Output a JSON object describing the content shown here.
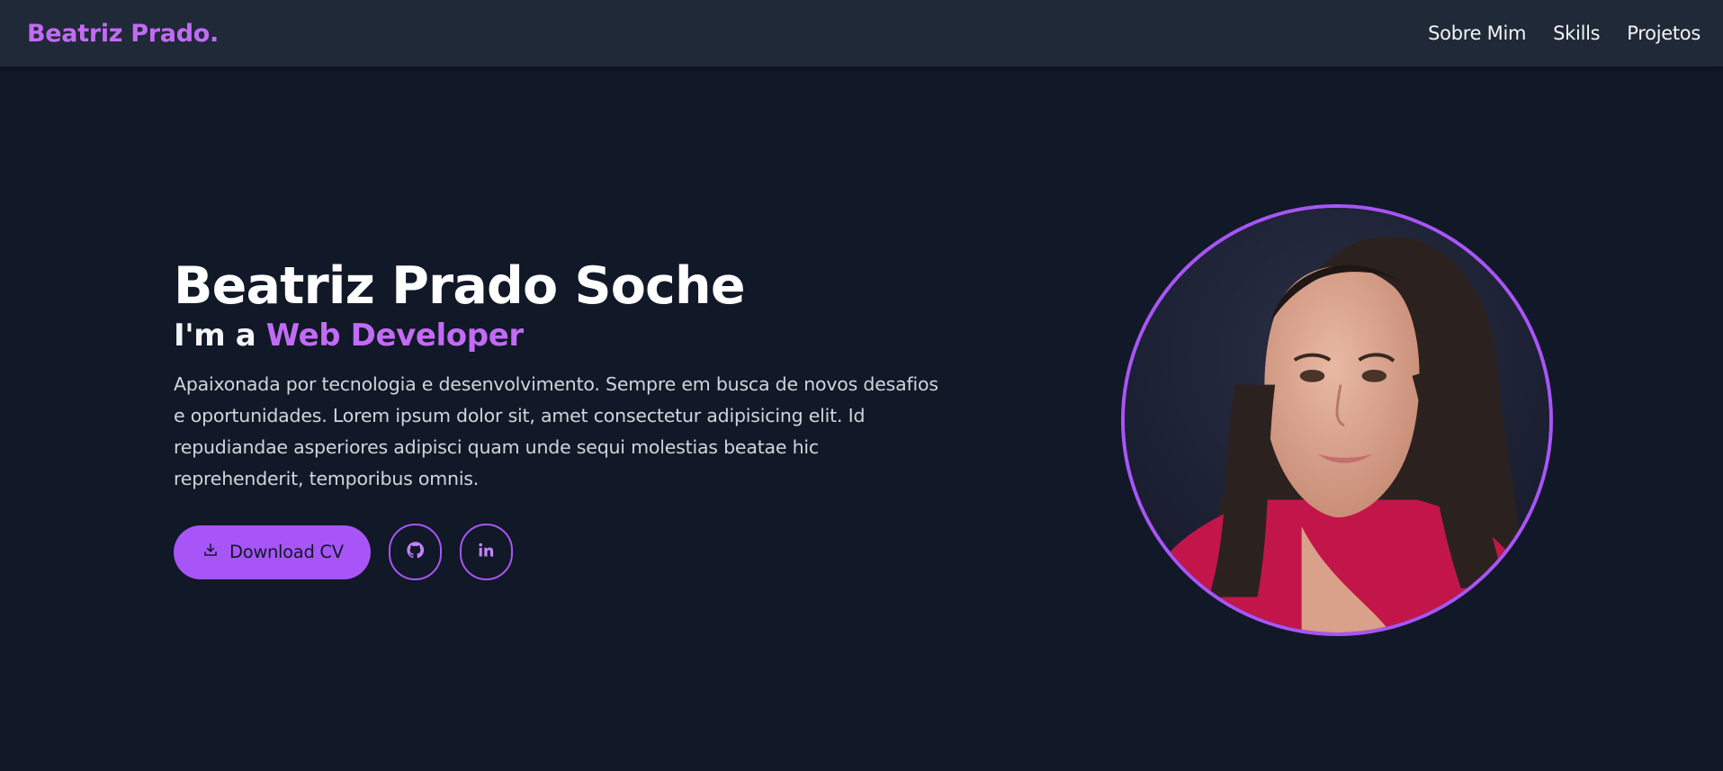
{
  "nav": {
    "logo": "Beatriz Prado.",
    "links": [
      {
        "label": "Sobre Mim"
      },
      {
        "label": "Skills"
      },
      {
        "label": "Projetos"
      }
    ]
  },
  "hero": {
    "name": "Beatriz Prado Soche",
    "role_prefix": "I'm a",
    "role_highlight": "Web Developer",
    "description": "Apaixonada por tecnologia e desenvolvimento. Sempre em busca de novos desafios e oportunidades. Lorem ipsum dolor sit, amet consectetur adipisicing elit. Id repudiandae asperiores adipisci quam unde sequi molestias beatae hic reprehenderit, temporibus omnis.",
    "download_label": "Download CV",
    "icons": {
      "download": "download-icon",
      "github": "github-icon",
      "linkedin": "linkedin-icon"
    }
  },
  "colors": {
    "background": "#111827",
    "navbar": "#1f2937",
    "accent": "#a855f7",
    "accent_text": "#c26bf5"
  }
}
